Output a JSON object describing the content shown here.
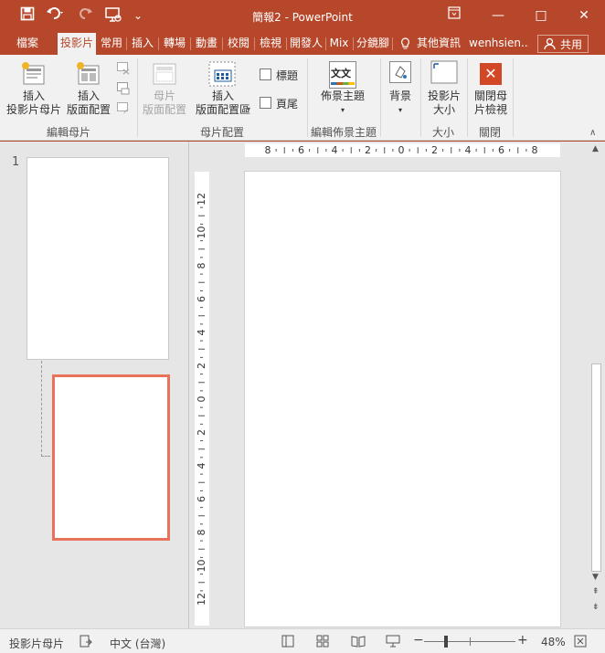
{
  "window": {
    "title": "簡報2 - PowerPoint",
    "minimize_glyph": "—",
    "restore_glyph": "□",
    "close_glyph": "✕"
  },
  "quick_access": {
    "save_icon": "save-icon",
    "undo_icon": "undo-icon",
    "redo_icon": "redo-icon",
    "present_icon": "presentation-icon",
    "customize_glyph": "⌄"
  },
  "tabs": [
    {
      "label": "檔案",
      "active": false
    },
    {
      "label": "投影片",
      "active": true
    },
    {
      "label": "常用",
      "active": false
    },
    {
      "label": "插入",
      "active": false
    },
    {
      "label": "轉場",
      "active": false
    },
    {
      "label": "動畫",
      "active": false
    },
    {
      "label": "校閱",
      "active": false
    },
    {
      "label": "檢視",
      "active": false
    },
    {
      "label": "開發人",
      "active": false
    },
    {
      "label": "Mix",
      "active": false
    },
    {
      "label": "分鏡腳",
      "active": false
    }
  ],
  "tellme": "其他資訊",
  "user": "wenhsien...",
  "share": "共用",
  "ribbon": {
    "insert_slide_master": [
      "插入",
      "投影片母片"
    ],
    "insert_layout": [
      "插入",
      "版面配置"
    ],
    "edit_master_group": "編輯母片",
    "master_button": [
      "母片",
      "版面配置"
    ],
    "insert_placeholder": [
      "插入",
      "版面配置區"
    ],
    "title_check": "標題",
    "footer_check": "頁尾",
    "master_layout_group": "母片配置",
    "themes_button": "佈景主題",
    "themes_icon_text": "文文",
    "edit_theme_group": "編輯佈景主題",
    "background_button": "背景",
    "slide_size_button": [
      "投影片",
      "大小"
    ],
    "size_group": "大小",
    "close_master": [
      "關閉母",
      "片檢視"
    ],
    "close_group": "關閉"
  },
  "thumbnails": {
    "slide_number": "1"
  },
  "rulers": {
    "horizontal": [
      "8",
      "6",
      "4",
      "2",
      "0",
      "2",
      "4",
      "6",
      "8"
    ],
    "vertical": [
      "12",
      "10",
      "8",
      "6",
      "4",
      "2",
      "0",
      "2",
      "4",
      "6",
      "8",
      "10",
      "12"
    ]
  },
  "status": {
    "view": "投影片母片",
    "language": "中文 (台灣)",
    "zoom": "48%",
    "zoom_level": 0.48
  }
}
